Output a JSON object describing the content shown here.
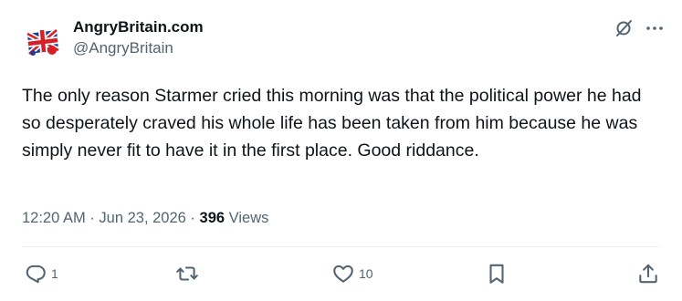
{
  "user": {
    "display_name": "AngryBritain.com",
    "handle": "@AngryBritain"
  },
  "tweet": {
    "text": "The only reason Starmer cried this morning was that the political power he had so desperately craved his whole life has been taken from him because he was simply never fit to have it in the first place. Good riddance.",
    "time": "12:20 AM",
    "date": "Jun 23, 2026",
    "separator": "·",
    "views_count": "396",
    "views_label": "Views"
  },
  "actions": {
    "reply_count": "1",
    "retweet_count": "",
    "like_count": "10"
  },
  "icons": {
    "avatar": "union-jack-avatar",
    "grok": "grok-icon",
    "more": "more-icon",
    "reply": "reply-icon",
    "retweet": "retweet-icon",
    "like": "heart-icon",
    "bookmark": "bookmark-icon",
    "share": "share-icon"
  },
  "colors": {
    "text_primary": "#0f1419",
    "text_secondary": "#536471",
    "divider": "#eff3f4"
  }
}
